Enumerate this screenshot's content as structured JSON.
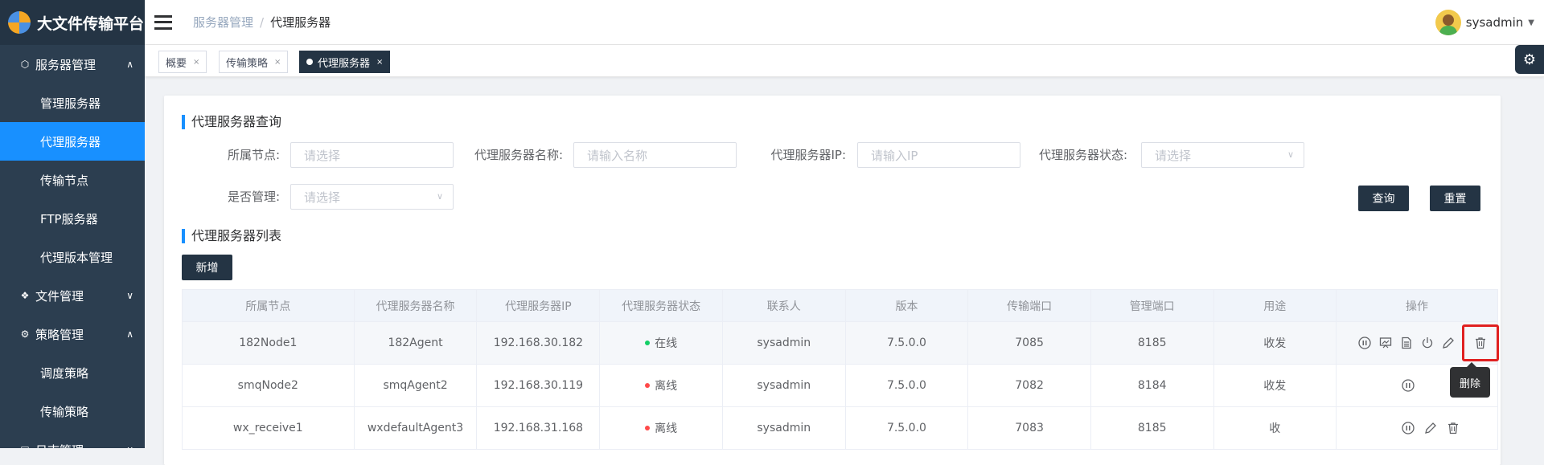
{
  "app": {
    "title": "大文件传输平台"
  },
  "sidebar": {
    "groups": [
      {
        "label": "服务器管理",
        "expanded": true,
        "items": [
          "管理服务器",
          "代理服务器",
          "传输节点",
          "FTP服务器",
          "代理版本管理"
        ],
        "active": "代理服务器"
      },
      {
        "label": "文件管理",
        "expanded": false
      },
      {
        "label": "策略管理",
        "expanded": true,
        "items": [
          "调度策略",
          "传输策略"
        ]
      },
      {
        "label": "日志管理",
        "expanded": false
      }
    ]
  },
  "header": {
    "breadcrumb": [
      "服务器管理",
      "代理服务器"
    ],
    "breadcrumb_sep": "/",
    "user": "sysadmin"
  },
  "tabs": [
    {
      "label": "概要",
      "close": "×"
    },
    {
      "label": "传输策略",
      "close": "×"
    },
    {
      "label": "代理服务器",
      "close": "×",
      "active": true
    }
  ],
  "query": {
    "title": "代理服务器查询",
    "node_label": "所属节点:",
    "node_placeholder": "请选择",
    "name_label": "代理服务器名称:",
    "name_placeholder": "请输入名称",
    "ip_label": "代理服务器IP:",
    "ip_placeholder": "请输入IP",
    "status_label": "代理服务器状态:",
    "status_placeholder": "请选择",
    "managed_label": "是否管理:",
    "managed_placeholder": "请选择",
    "search_button": "查询",
    "reset_button": "重置"
  },
  "list": {
    "title": "代理服务器列表",
    "add_button": "新增",
    "columns": [
      "所属节点",
      "代理服务器名称",
      "代理服务器IP",
      "代理服务器状态",
      "联系人",
      "版本",
      "传输端口",
      "管理端口",
      "用途",
      "操作"
    ],
    "rows": [
      {
        "node": "182Node1",
        "name": "182Agent",
        "ip": "192.168.30.182",
        "status": "在线",
        "status_color": "#13ce66",
        "contact": "sysadmin",
        "version": "7.5.0.0",
        "tport": "7085",
        "mport": "8185",
        "usage": "收发"
      },
      {
        "node": "smqNode2",
        "name": "smqAgent2",
        "ip": "192.168.30.119",
        "status": "离线",
        "status_color": "#ff4949",
        "contact": "sysadmin",
        "version": "7.5.0.0",
        "tport": "7082",
        "mport": "8184",
        "usage": "收发"
      },
      {
        "node": "wx_receive1",
        "name": "wxdefaultAgent3",
        "ip": "192.168.31.168",
        "status": "离线",
        "status_color": "#ff4949",
        "contact": "sysadmin",
        "version": "7.5.0.0",
        "tport": "7083",
        "mport": "8185",
        "usage": "收"
      }
    ]
  },
  "tooltip": {
    "text": "删除"
  },
  "icons": [
    "hamburger-icon",
    "gear-icon",
    "pause-icon",
    "monitor-icon",
    "document-icon",
    "power-icon",
    "edit-icon",
    "trash-icon",
    "chevron-down-icon",
    "chevron-up-icon"
  ]
}
